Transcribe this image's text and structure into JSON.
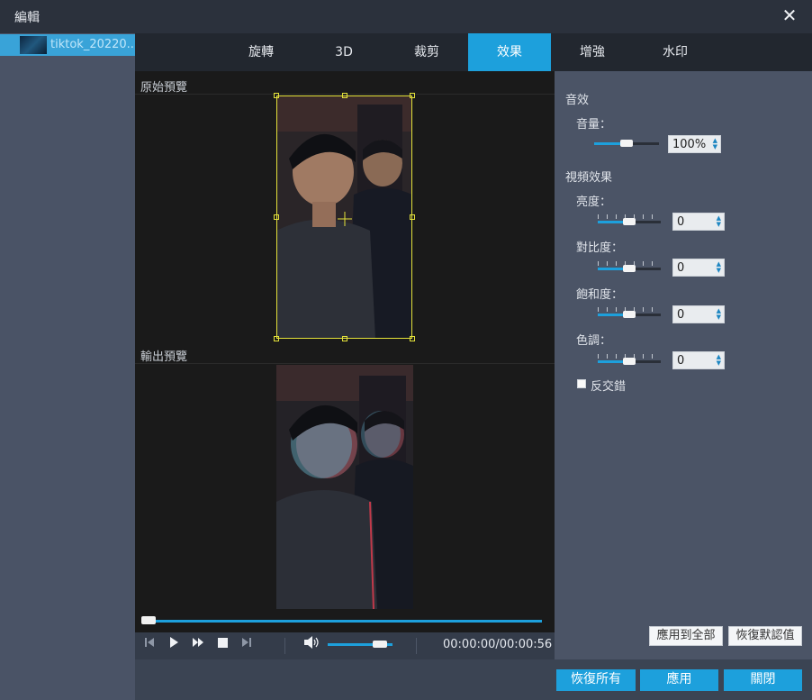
{
  "window": {
    "title": "編輯",
    "close_label": "✕"
  },
  "file": {
    "name": "tiktok_20220..."
  },
  "tabs": [
    {
      "label": "旋轉"
    },
    {
      "label": "3D"
    },
    {
      "label": "裁剪"
    },
    {
      "label": "效果",
      "active": true
    },
    {
      "label": "增強"
    },
    {
      "label": "水印"
    }
  ],
  "preview": {
    "original_label": "原始預覽",
    "output_label": "輸出預覽"
  },
  "player": {
    "progress_fraction": 0.0,
    "volume_fraction": 0.9,
    "time": "00:00:00/00:00:56"
  },
  "effects": {
    "audio_heading": "音效",
    "volume_label": "音量：",
    "volume_value": "100%",
    "video_heading": "視頻效果",
    "brightness_label": "亮度：",
    "brightness_value": "0",
    "contrast_label": "對比度：",
    "contrast_value": "0",
    "saturation_label": "飽和度：",
    "saturation_value": "0",
    "hue_label": "色調：",
    "hue_value": "0",
    "deinterlace_label": "反交錯",
    "deinterlace_checked": false
  },
  "buttons": {
    "apply_all": "應用到全部",
    "restore_default": "恢復默認值",
    "restore_all": "恢復所有",
    "apply": "應用",
    "close": "關閉"
  },
  "colors": {
    "accent": "#1da0dc",
    "crop_border": "#e4e23a"
  }
}
